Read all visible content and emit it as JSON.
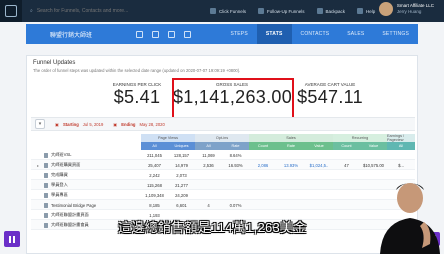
{
  "topbar": {
    "search_placeholder": "Search for Funnels, Contacts and more...",
    "links": [
      "Click Funnels",
      "Follow-Up Funnels",
      "Backpack",
      "Help"
    ],
    "account_name": "Smart Affiliate LLC",
    "account_sub": "Jerry Huang"
  },
  "subnav": {
    "funnel_name": "聯盟行銷大師班",
    "tabs": [
      "STEPS",
      "STATS",
      "CONTACTS",
      "SALES",
      "SETTINGS"
    ],
    "active_tab": "STATS"
  },
  "panel": {
    "title": "Funnel Updates",
    "note": "The order of funnel steps was updated within the selected date range (updated on 2020-07-07 19:09:19 +0800)."
  },
  "stats": {
    "epc_label": "EARNINGS PER CLICK",
    "epc_value": "$5.41",
    "gross_label": "GROSS SALES",
    "gross_value": "$1,141,263.00",
    "acv_label": "AVERAGE CART VALUE",
    "acv_value": "$547.11"
  },
  "filters": {
    "starting_label": "Starting",
    "starting_value": "Jul 5, 2019",
    "ending_label": "Ending",
    "ending_value": "May 28, 2020"
  },
  "table": {
    "groups": [
      "Page Views",
      "Opt-ins",
      "Sales",
      "Recurring",
      "Earnings / Pageview"
    ],
    "subheaders": [
      "All",
      "Uniques",
      "All",
      "Rate",
      "Count",
      "Rate",
      "Value",
      "Count",
      "Value",
      "All"
    ],
    "rows": [
      {
        "name": "大師班VSL",
        "chev": "",
        "cells": [
          "211,045",
          "128,157",
          "11,069",
          "8.64%",
          "",
          "",
          "",
          "",
          "",
          ""
        ]
      },
      {
        "name": "大師班購買頁面",
        "chev": "▸",
        "cells": [
          "25,407",
          "14,979",
          "2,536",
          "16.93%",
          "2,086",
          "13.93%",
          "$1,024,5..",
          "47",
          "$10,575.00",
          "$..."
        ]
      },
      {
        "name": "完成購買",
        "chev": "",
        "cells": [
          "2,242",
          "2,073",
          "",
          "",
          "",
          "",
          "",
          "",
          "",
          ""
        ]
      },
      {
        "name": "學員登入",
        "chev": "",
        "cells": [
          "115,268",
          "21,277",
          "",
          "",
          "",
          "",
          "",
          "",
          "",
          ""
        ]
      },
      {
        "name": "學員專區",
        "chev": "",
        "cells": [
          "1,109,348",
          "24,209",
          "",
          "",
          "",
          "",
          "",
          "",
          "",
          ""
        ]
      },
      {
        "name": "Testimonial Bridge Page",
        "chev": "",
        "cells": [
          "8,185",
          "6,601",
          "4",
          "0.07%",
          "",
          "",
          "",
          "",
          "",
          ""
        ]
      },
      {
        "name": "大師班聯盟計畫頁面",
        "chev": "",
        "cells": [
          "1,193",
          "",
          "",
          "",
          "",
          "",
          "",
          "",
          "",
          ""
        ]
      },
      {
        "name": "大師班聯盟計畫會員",
        "chev": "",
        "cells": [
          "",
          "",
          "",
          "",
          "",
          "",
          "",
          "",
          "",
          ""
        ]
      }
    ]
  },
  "caption": "這邊總銷售額是114萬1,263美金"
}
